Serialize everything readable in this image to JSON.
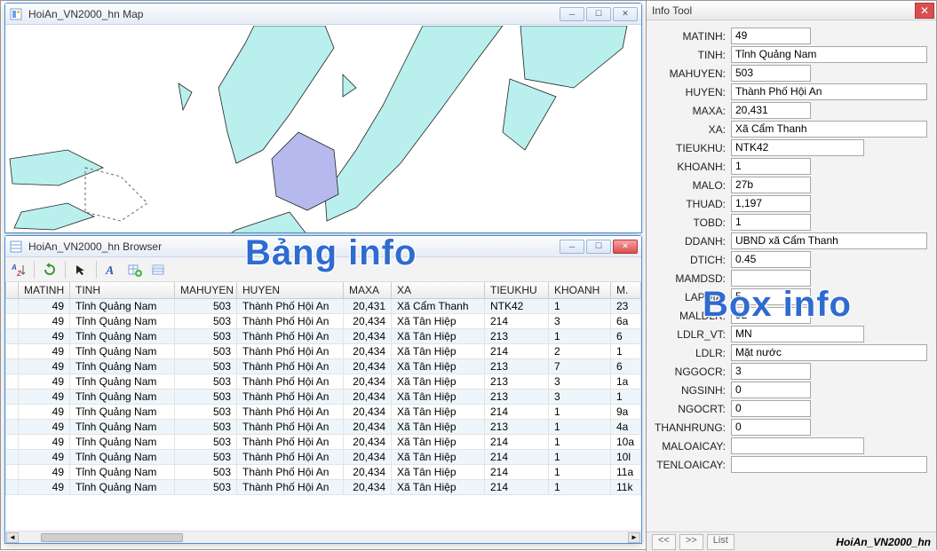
{
  "map_window": {
    "title": "HoiAn_VN2000_hn Map"
  },
  "browser_window": {
    "title": "HoiAn_VN2000_hn Browser",
    "columns": [
      "MATINH",
      "TINH",
      "MAHUYEN",
      "HUYEN",
      "MAXA",
      "XA",
      "TIEUKHU",
      "KHOANH",
      "M."
    ],
    "rows": [
      {
        "MATINH": "49",
        "TINH": "Tỉnh Quảng Nam",
        "MAHUYEN": "503",
        "HUYEN": "Thành Phố Hội An",
        "MAXA": "20,431",
        "XA": "Xã Cẩm Thanh",
        "TIEUKHU": "NTK42",
        "KHOANH": "1",
        "M": "23"
      },
      {
        "MATINH": "49",
        "TINH": "Tỉnh Quảng Nam",
        "MAHUYEN": "503",
        "HUYEN": "Thành Phố Hội An",
        "MAXA": "20,434",
        "XA": "Xã Tân Hiệp",
        "TIEUKHU": "214",
        "KHOANH": "3",
        "M": "6a"
      },
      {
        "MATINH": "49",
        "TINH": "Tỉnh Quảng Nam",
        "MAHUYEN": "503",
        "HUYEN": "Thành Phố Hội An",
        "MAXA": "20,434",
        "XA": "Xã Tân Hiệp",
        "TIEUKHU": "213",
        "KHOANH": "1",
        "M": "6"
      },
      {
        "MATINH": "49",
        "TINH": "Tỉnh Quảng Nam",
        "MAHUYEN": "503",
        "HUYEN": "Thành Phố Hội An",
        "MAXA": "20,434",
        "XA": "Xã Tân Hiệp",
        "TIEUKHU": "214",
        "KHOANH": "2",
        "M": "1"
      },
      {
        "MATINH": "49",
        "TINH": "Tỉnh Quảng Nam",
        "MAHUYEN": "503",
        "HUYEN": "Thành Phố Hội An",
        "MAXA": "20,434",
        "XA": "Xã Tân Hiệp",
        "TIEUKHU": "213",
        "KHOANH": "7",
        "M": "6"
      },
      {
        "MATINH": "49",
        "TINH": "Tỉnh Quảng Nam",
        "MAHUYEN": "503",
        "HUYEN": "Thành Phố Hội An",
        "MAXA": "20,434",
        "XA": "Xã Tân Hiệp",
        "TIEUKHU": "213",
        "KHOANH": "3",
        "M": "1a"
      },
      {
        "MATINH": "49",
        "TINH": "Tỉnh Quảng Nam",
        "MAHUYEN": "503",
        "HUYEN": "Thành Phố Hội An",
        "MAXA": "20,434",
        "XA": "Xã Tân Hiệp",
        "TIEUKHU": "213",
        "KHOANH": "3",
        "M": "1"
      },
      {
        "MATINH": "49",
        "TINH": "Tỉnh Quảng Nam",
        "MAHUYEN": "503",
        "HUYEN": "Thành Phố Hội An",
        "MAXA": "20,434",
        "XA": "Xã Tân Hiệp",
        "TIEUKHU": "214",
        "KHOANH": "1",
        "M": "9a"
      },
      {
        "MATINH": "49",
        "TINH": "Tỉnh Quảng Nam",
        "MAHUYEN": "503",
        "HUYEN": "Thành Phố Hội An",
        "MAXA": "20,434",
        "XA": "Xã Tân Hiệp",
        "TIEUKHU": "213",
        "KHOANH": "1",
        "M": "4a"
      },
      {
        "MATINH": "49",
        "TINH": "Tỉnh Quảng Nam",
        "MAHUYEN": "503",
        "HUYEN": "Thành Phố Hội An",
        "MAXA": "20,434",
        "XA": "Xã Tân Hiệp",
        "TIEUKHU": "214",
        "KHOANH": "1",
        "M": "10a"
      },
      {
        "MATINH": "49",
        "TINH": "Tỉnh Quảng Nam",
        "MAHUYEN": "503",
        "HUYEN": "Thành Phố Hội An",
        "MAXA": "20,434",
        "XA": "Xã Tân Hiệp",
        "TIEUKHU": "214",
        "KHOANH": "1",
        "M": "10l"
      },
      {
        "MATINH": "49",
        "TINH": "Tỉnh Quảng Nam",
        "MAHUYEN": "503",
        "HUYEN": "Thành Phố Hội An",
        "MAXA": "20,434",
        "XA": "Xã Tân Hiệp",
        "TIEUKHU": "214",
        "KHOANH": "1",
        "M": "11a"
      },
      {
        "MATINH": "49",
        "TINH": "Tỉnh Quảng Nam",
        "MAHUYEN": "503",
        "HUYEN": "Thành Phố Hội An",
        "MAXA": "20,434",
        "XA": "Xã Tân Hiệp",
        "TIEUKHU": "214",
        "KHOANH": "1",
        "M": "11k"
      }
    ]
  },
  "info_tool": {
    "title": "Info Tool",
    "fields": [
      {
        "label": "MATINH:",
        "value": "49",
        "size": "short"
      },
      {
        "label": "TINH:",
        "value": "Tỉnh Quảng Nam",
        "size": ""
      },
      {
        "label": "MAHUYEN:",
        "value": "503",
        "size": "short"
      },
      {
        "label": "HUYEN:",
        "value": "Thành Phố Hội An",
        "size": ""
      },
      {
        "label": "MAXA:",
        "value": "20,431",
        "size": "short"
      },
      {
        "label": "XA:",
        "value": "Xã Cẩm Thanh",
        "size": ""
      },
      {
        "label": "TIEUKHU:",
        "value": "NTK42",
        "size": "med"
      },
      {
        "label": "KHOANH:",
        "value": "1",
        "size": "short"
      },
      {
        "label": "MALO:",
        "value": "27b",
        "size": "short"
      },
      {
        "label": "THUAD:",
        "value": "1,197",
        "size": "short"
      },
      {
        "label": "TOBD:",
        "value": "1",
        "size": "short"
      },
      {
        "label": "DDANH:",
        "value": "UBND xã  Cẩm Thanh",
        "size": ""
      },
      {
        "label": "DTICH:",
        "value": "0.45",
        "size": "short"
      },
      {
        "label": "MAMDSD:",
        "value": "",
        "size": "short"
      },
      {
        "label": "LAPDIA:",
        "value": "5",
        "size": "short"
      },
      {
        "label": "MALDLR:",
        "value": "92",
        "size": "short"
      },
      {
        "label": "LDLR_VT:",
        "value": "MN",
        "size": "med"
      },
      {
        "label": "LDLR:",
        "value": "Mặt nước",
        "size": ""
      },
      {
        "label": "NGGOCR:",
        "value": "3",
        "size": "short"
      },
      {
        "label": "NGSINH:",
        "value": "0",
        "size": "short"
      },
      {
        "label": "NGOCRT:",
        "value": "0",
        "size": "short"
      },
      {
        "label": "THANHRUNG:",
        "value": "0",
        "size": "short"
      },
      {
        "label": "MALOAICAY:",
        "value": "",
        "size": "med"
      },
      {
        "label": "TENLOAICAY:",
        "value": "",
        "size": ""
      }
    ],
    "bottom": {
      "prev": "<<",
      "next": ">>",
      "list": "List",
      "name": "HoiAn_VN2000_hn"
    }
  },
  "labels": {
    "bang": "Bảng info",
    "box": "Box info"
  }
}
